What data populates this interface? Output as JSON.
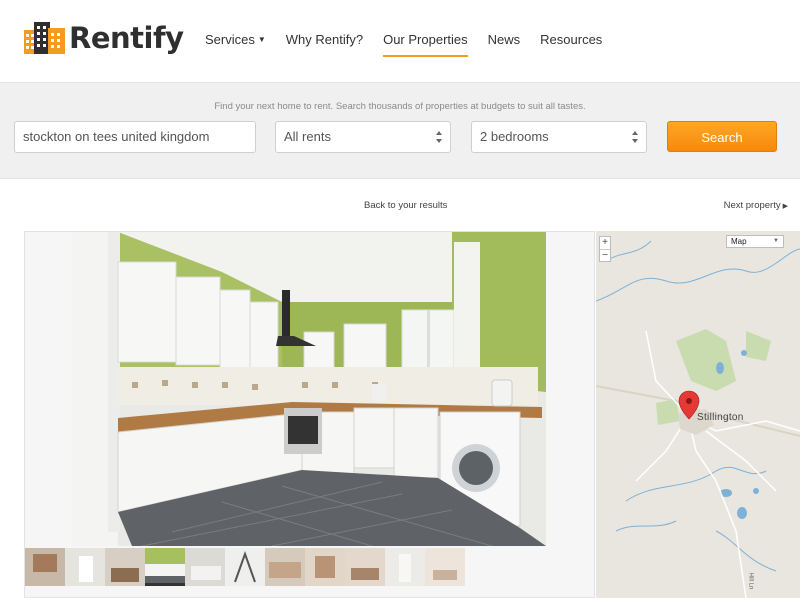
{
  "brand": {
    "name": "Rentify",
    "accent_color": "#f49c1e",
    "logo_icon": "buildings-icon"
  },
  "nav": {
    "items": [
      {
        "label": "Services",
        "has_dropdown": true,
        "active": false
      },
      {
        "label": "Why Rentify?",
        "has_dropdown": false,
        "active": false
      },
      {
        "label": "Our Properties",
        "has_dropdown": false,
        "active": true
      },
      {
        "label": "News",
        "has_dropdown": false,
        "active": false
      },
      {
        "label": "Resources",
        "has_dropdown": false,
        "active": false
      }
    ]
  },
  "search": {
    "tagline": "Find your next home to rent. Search thousands of properties at budgets to suit all tastes.",
    "location_value": "stockton on tees united kingdom",
    "rent_value": "All rents",
    "bedrooms_value": "2 bedrooms",
    "button_label": "Search",
    "button_color": "#f7890a"
  },
  "navigation_links": {
    "back_label": "Back to your results",
    "next_label": "Next property"
  },
  "gallery": {
    "main_photo": "kitchen-photo",
    "thumbnail_count": 11,
    "active_thumbnail": 3
  },
  "map": {
    "zoom_in": "+",
    "zoom_out": "−",
    "map_type": "Map",
    "place_label": "Stillington",
    "marker_icon": "map-pin-icon",
    "road_label": "Hill Ln"
  }
}
